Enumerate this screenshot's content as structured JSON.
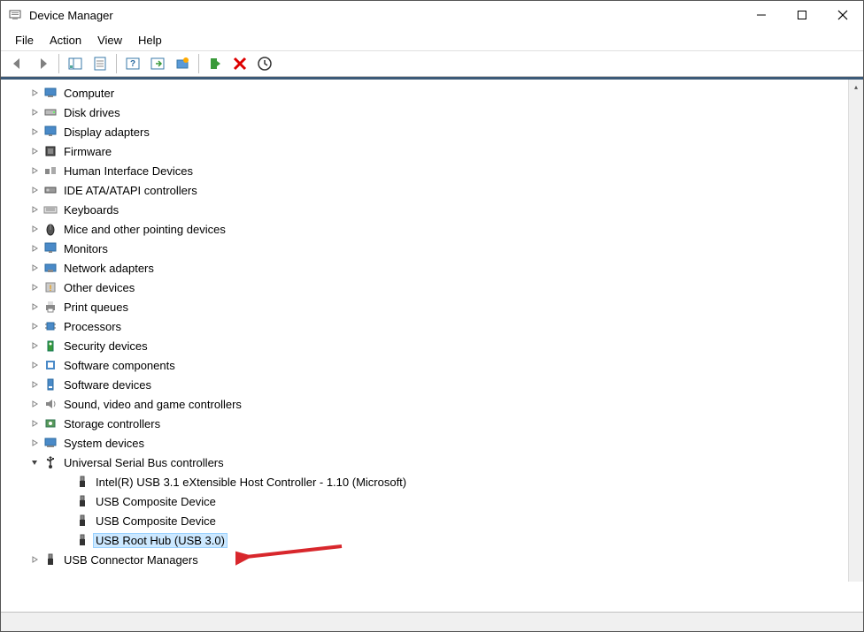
{
  "window": {
    "title": "Device Manager"
  },
  "menubar": {
    "items": [
      "File",
      "Action",
      "View",
      "Help"
    ]
  },
  "tree": {
    "items": [
      {
        "label": "Computer",
        "icon": "computer-icon",
        "expanded": false
      },
      {
        "label": "Disk drives",
        "icon": "disk-icon",
        "expanded": false
      },
      {
        "label": "Display adapters",
        "icon": "display-icon",
        "expanded": false
      },
      {
        "label": "Firmware",
        "icon": "firmware-icon",
        "expanded": false
      },
      {
        "label": "Human Interface Devices",
        "icon": "hid-icon",
        "expanded": false
      },
      {
        "label": "IDE ATA/ATAPI controllers",
        "icon": "ide-icon",
        "expanded": false
      },
      {
        "label": "Keyboards",
        "icon": "keyboard-icon",
        "expanded": false
      },
      {
        "label": "Mice and other pointing devices",
        "icon": "mouse-icon",
        "expanded": false
      },
      {
        "label": "Monitors",
        "icon": "monitor-icon",
        "expanded": false
      },
      {
        "label": "Network adapters",
        "icon": "network-icon",
        "expanded": false
      },
      {
        "label": "Other devices",
        "icon": "other-icon",
        "expanded": false
      },
      {
        "label": "Print queues",
        "icon": "print-icon",
        "expanded": false
      },
      {
        "label": "Processors",
        "icon": "processor-icon",
        "expanded": false
      },
      {
        "label": "Security devices",
        "icon": "security-icon",
        "expanded": false
      },
      {
        "label": "Software components",
        "icon": "software-comp-icon",
        "expanded": false
      },
      {
        "label": "Software devices",
        "icon": "software-dev-icon",
        "expanded": false
      },
      {
        "label": "Sound, video and game controllers",
        "icon": "sound-icon",
        "expanded": false
      },
      {
        "label": "Storage controllers",
        "icon": "storage-icon",
        "expanded": false
      },
      {
        "label": "System devices",
        "icon": "system-icon",
        "expanded": false
      },
      {
        "label": "Universal Serial Bus controllers",
        "icon": "usb-icon",
        "expanded": true,
        "children": [
          {
            "label": "Intel(R) USB 3.1 eXtensible Host Controller - 1.10 (Microsoft)",
            "icon": "usb-plug-icon"
          },
          {
            "label": "USB Composite Device",
            "icon": "usb-plug-icon"
          },
          {
            "label": "USB Composite Device",
            "icon": "usb-plug-icon"
          },
          {
            "label": "USB Root Hub (USB 3.0)",
            "icon": "usb-plug-icon",
            "selected": true
          }
        ]
      },
      {
        "label": "USB Connector Managers",
        "icon": "usb-plug-icon",
        "expanded": false
      }
    ]
  }
}
